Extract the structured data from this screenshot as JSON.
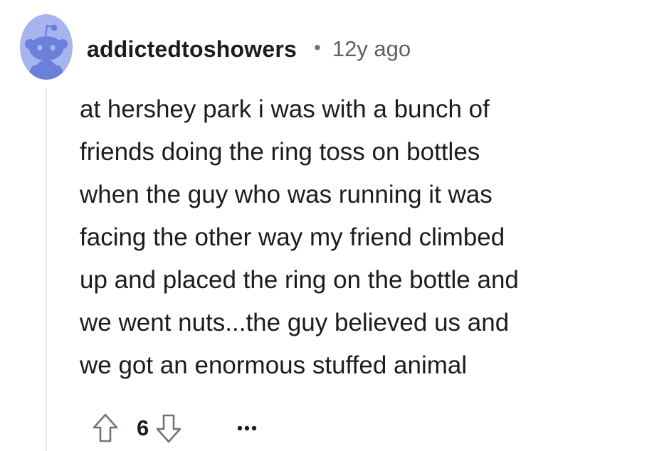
{
  "comment": {
    "author": "addictedtoshowers",
    "separator": "•",
    "age": "12y ago",
    "body_lines": [
      "at hershey park i was with a bunch of",
      "friends doing the ring toss on bottles",
      "when the guy who was running it was",
      "facing the other way my friend climbed",
      "up and placed the ring on the bottle and",
      "we went nuts...the guy believed us and",
      "we got an enormous stuffed animal"
    ],
    "score": "6",
    "more_label": "•••"
  },
  "icons": {
    "avatar": "snoo-avatar-icon",
    "upvote": "upvote-arrow-icon",
    "downvote": "downvote-arrow-icon",
    "more": "more-options-icon"
  },
  "colors": {
    "avatar_bg": "#a7b5ef",
    "snoo": "#6b80d8",
    "text": "#1c1c1c",
    "meta": "#5c6166",
    "thread_line": "#e6e8ea"
  }
}
